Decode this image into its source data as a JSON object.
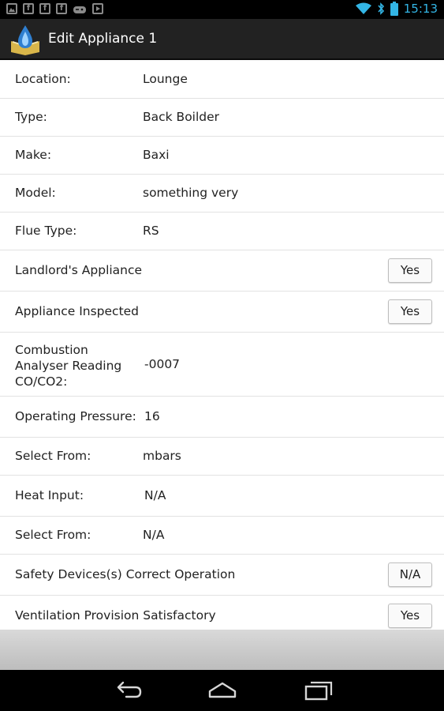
{
  "status_bar": {
    "time": "15:13",
    "left_icons": [
      "image-notification-icon",
      "facebook-icon",
      "facebook-icon",
      "facebook-icon",
      "gamepad-icon",
      "youtube-icon"
    ],
    "right_icons": [
      "wifi-icon",
      "bluetooth-icon",
      "battery-icon"
    ]
  },
  "action_bar": {
    "title": "Edit Appliance 1"
  },
  "form": {
    "location": {
      "label": "Location:",
      "value": "Lounge"
    },
    "type": {
      "label": "Type:",
      "value": "Back Boilder"
    },
    "make": {
      "label": "Make:",
      "value": "Baxi"
    },
    "model": {
      "label": "Model:",
      "value": "something very"
    },
    "flue_type": {
      "label": "Flue Type:",
      "value": "RS"
    },
    "landlords_appliance": {
      "label": "Landlord's Appliance",
      "value": "Yes"
    },
    "appliance_inspected": {
      "label": "Appliance Inspected",
      "value": "Yes"
    },
    "combustion": {
      "label": "Combustion Analyser Reading CO/CO2:",
      "value": "-0007"
    },
    "operating_pressure": {
      "label": "Operating Pressure:",
      "value": "16"
    },
    "pressure_unit": {
      "label": "Select From:",
      "value": "mbars"
    },
    "heat_input": {
      "label": "Heat Input:",
      "value": "N/A"
    },
    "heat_input_unit": {
      "label": "Select From:",
      "value": "N/A"
    },
    "safety_devices": {
      "label": "Safety Devices(s) Correct Operation",
      "value": "N/A"
    },
    "ventilation": {
      "label": "Ventilation Provision Satisfactory",
      "value": "Yes"
    }
  },
  "nav_bar": {
    "icons": [
      "back-icon",
      "home-icon",
      "recent-apps-icon"
    ]
  },
  "colors": {
    "status_accent": "#33b5e5",
    "action_bar": "#222222",
    "row_divider": "#e2e2e2"
  }
}
